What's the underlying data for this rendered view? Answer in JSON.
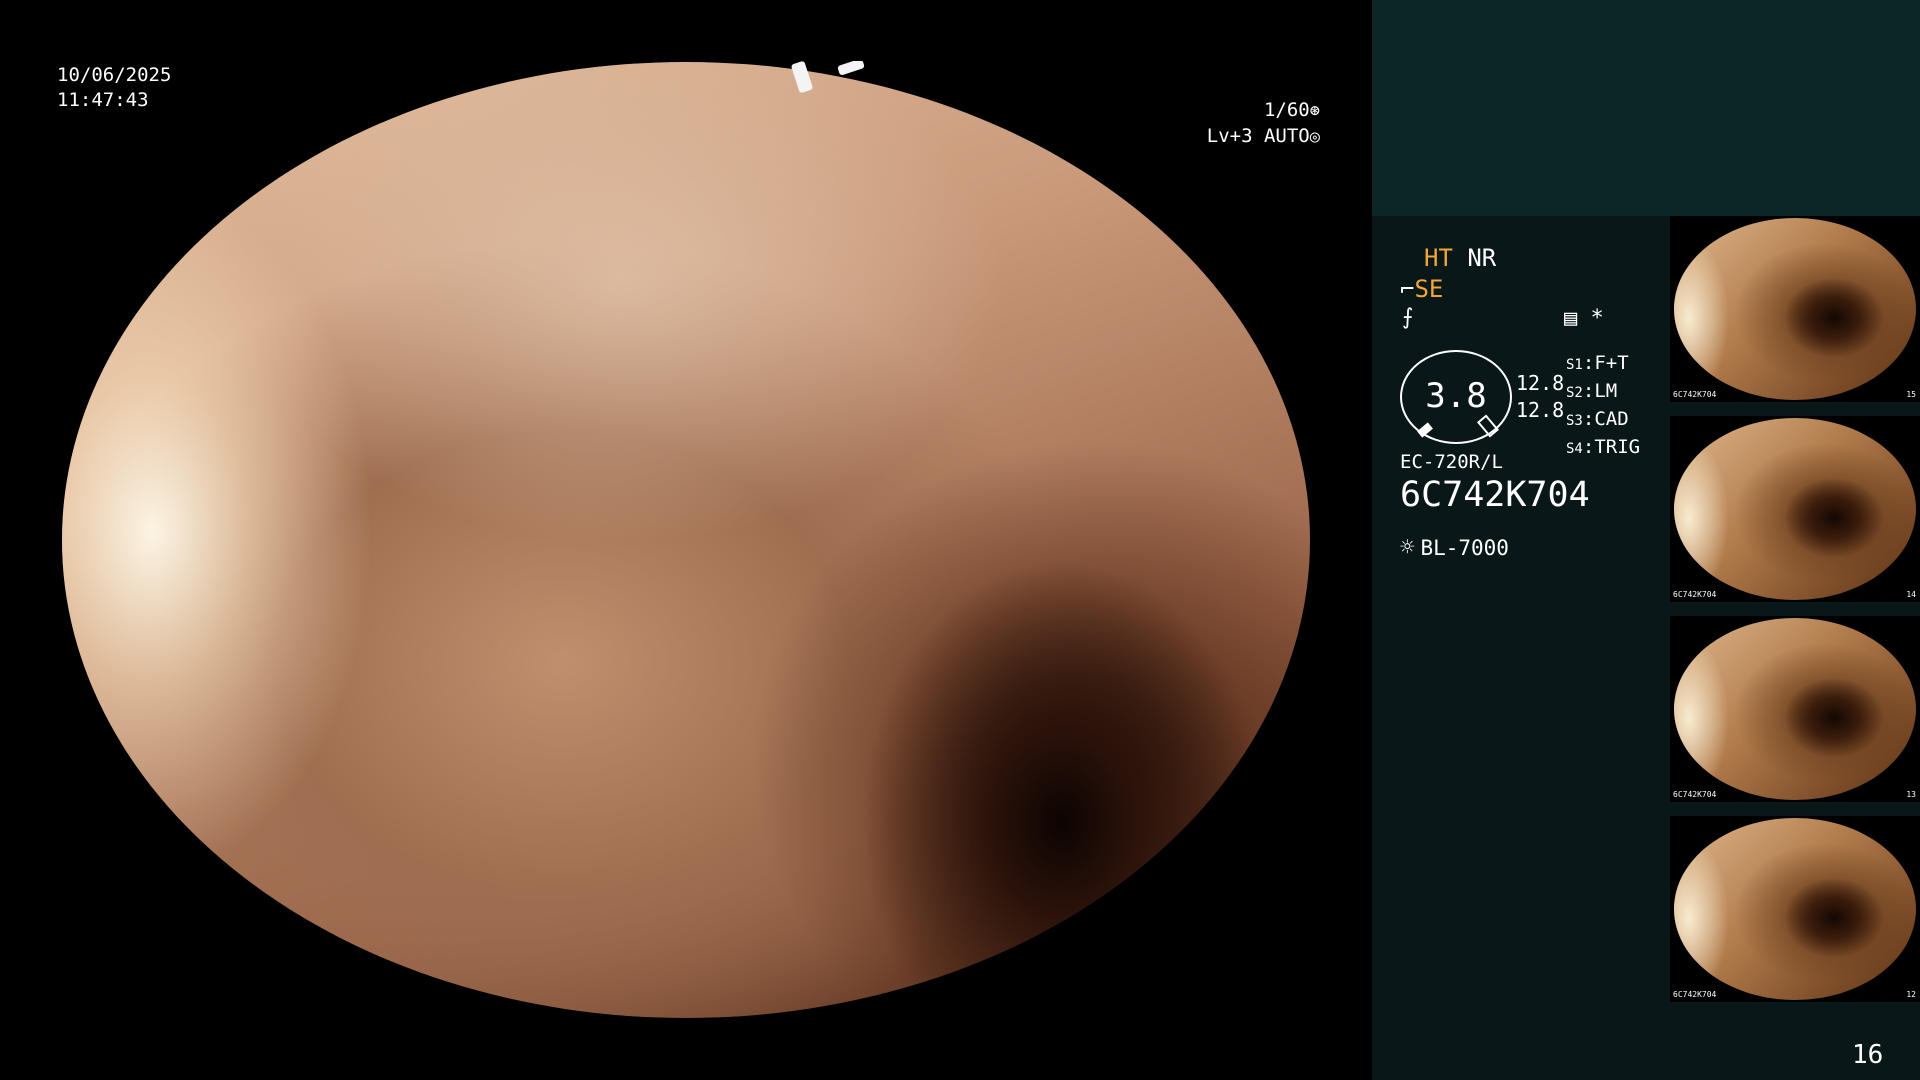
{
  "overlay": {
    "date": "10/06/2025",
    "time": "11:47:43",
    "shutter": "1/60",
    "shutter_icon": "⊛",
    "level": "Lv+3",
    "iris_mode": "AUTO",
    "iris_icon": "◎"
  },
  "panel": {
    "mode_ht": "HT",
    "mode_nr": "NR",
    "mode_se_icon": "⌐",
    "mode_se": "SE",
    "mode_f_icon": "⨍",
    "menu_icon": "▤",
    "asterisk": "*",
    "ratio": "3.8",
    "gain_1": "12.8",
    "gain_2": "12.8",
    "switches": [
      {
        "key": "S1",
        "value": "F+T"
      },
      {
        "key": "S2",
        "value": "LM"
      },
      {
        "key": "S3",
        "value": "CAD"
      },
      {
        "key": "S4",
        "value": "TRIG"
      }
    ],
    "scope_model": "EC-720R/L",
    "scope_serial": "6C742K704",
    "light_icon": "☼",
    "light_source": "BL-7000",
    "image_counter": "16"
  },
  "thumbnails": [
    {
      "serial": "6C742K704",
      "num": "15"
    },
    {
      "serial": "6C742K704",
      "num": "14"
    },
    {
      "serial": "6C742K704",
      "num": "13"
    },
    {
      "serial": "6C742K704",
      "num": "12"
    }
  ],
  "colors": {
    "accent_orange": "#f1a637",
    "panel_bg": "#0a1718",
    "panel_top_bg": "#0b2627"
  }
}
